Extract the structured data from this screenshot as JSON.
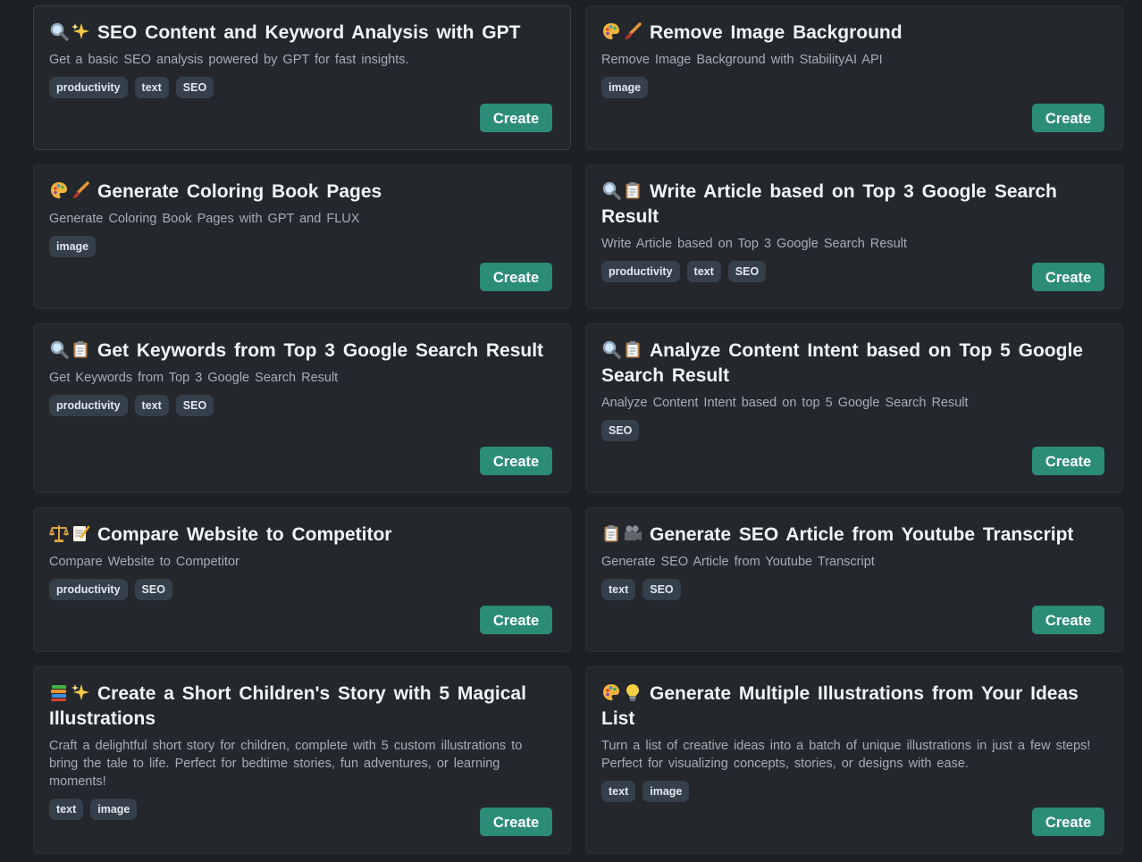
{
  "create_label": "Create",
  "cards": [
    {
      "title": "SEO Content and Keyword Analysis with GPT",
      "emojis": [
        "magnifier-icon",
        "sparkles-icon"
      ],
      "description": "Get a basic SEO analysis powered by GPT for fast insights.",
      "tags": [
        "productivity",
        "text",
        "SEO"
      ]
    },
    {
      "title": "Remove Image Background",
      "emojis": [
        "palette-icon",
        "brush-icon"
      ],
      "description": "Remove Image Background with StabilityAI API",
      "tags": [
        "image"
      ]
    },
    {
      "title": "Generate Coloring Book Pages",
      "emojis": [
        "palette-icon",
        "brush-icon"
      ],
      "description": "Generate Coloring Book Pages with GPT and FLUX",
      "tags": [
        "image"
      ]
    },
    {
      "title": "Write Article based on Top 3 Google Search Result",
      "emojis": [
        "magnifier-icon",
        "clipboard-icon"
      ],
      "description": "Write Article based on Top 3 Google Search Result",
      "tags": [
        "productivity",
        "text",
        "SEO"
      ]
    },
    {
      "title": "Get Keywords from Top 3 Google Search Result",
      "emojis": [
        "magnifier-icon",
        "clipboard-icon"
      ],
      "description": "Get Keywords from Top 3 Google Search Result",
      "tags": [
        "productivity",
        "text",
        "SEO"
      ]
    },
    {
      "title": "Analyze Content Intent based on Top 5 Google Search Result",
      "emojis": [
        "magnifier-icon",
        "clipboard-icon"
      ],
      "description": "Analyze Content Intent based on top 5 Google Search Result",
      "tags": [
        "SEO"
      ]
    },
    {
      "title": "Compare Website to Competitor",
      "emojis": [
        "scales-icon",
        "memo-icon"
      ],
      "description": "Compare Website to Competitor",
      "tags": [
        "productivity",
        "SEO"
      ]
    },
    {
      "title": "Generate SEO Article from Youtube Transcript",
      "emojis": [
        "clipboard-icon",
        "camera-icon"
      ],
      "description": "Generate SEO Article from Youtube Transcript",
      "tags": [
        "text",
        "SEO"
      ]
    },
    {
      "title": "Create a Short Children's Story with 5 Magical Illustrations",
      "emojis": [
        "books-icon",
        "sparkles-icon"
      ],
      "description": "Craft a delightful short story for children, complete with 5 custom illustrations to bring the tale to life. Perfect for bedtime stories, fun adventures, or learning moments!",
      "tags": [
        "text",
        "image"
      ]
    },
    {
      "title": "Generate Multiple Illustrations from Your Ideas List",
      "emojis": [
        "palette-icon",
        "lightbulb-icon"
      ],
      "description": "Turn a list of creative ideas into a batch of unique illustrations in just a few steps! Perfect for visualizing concepts, stories, or designs with ease.",
      "tags": [
        "text",
        "image"
      ]
    }
  ]
}
